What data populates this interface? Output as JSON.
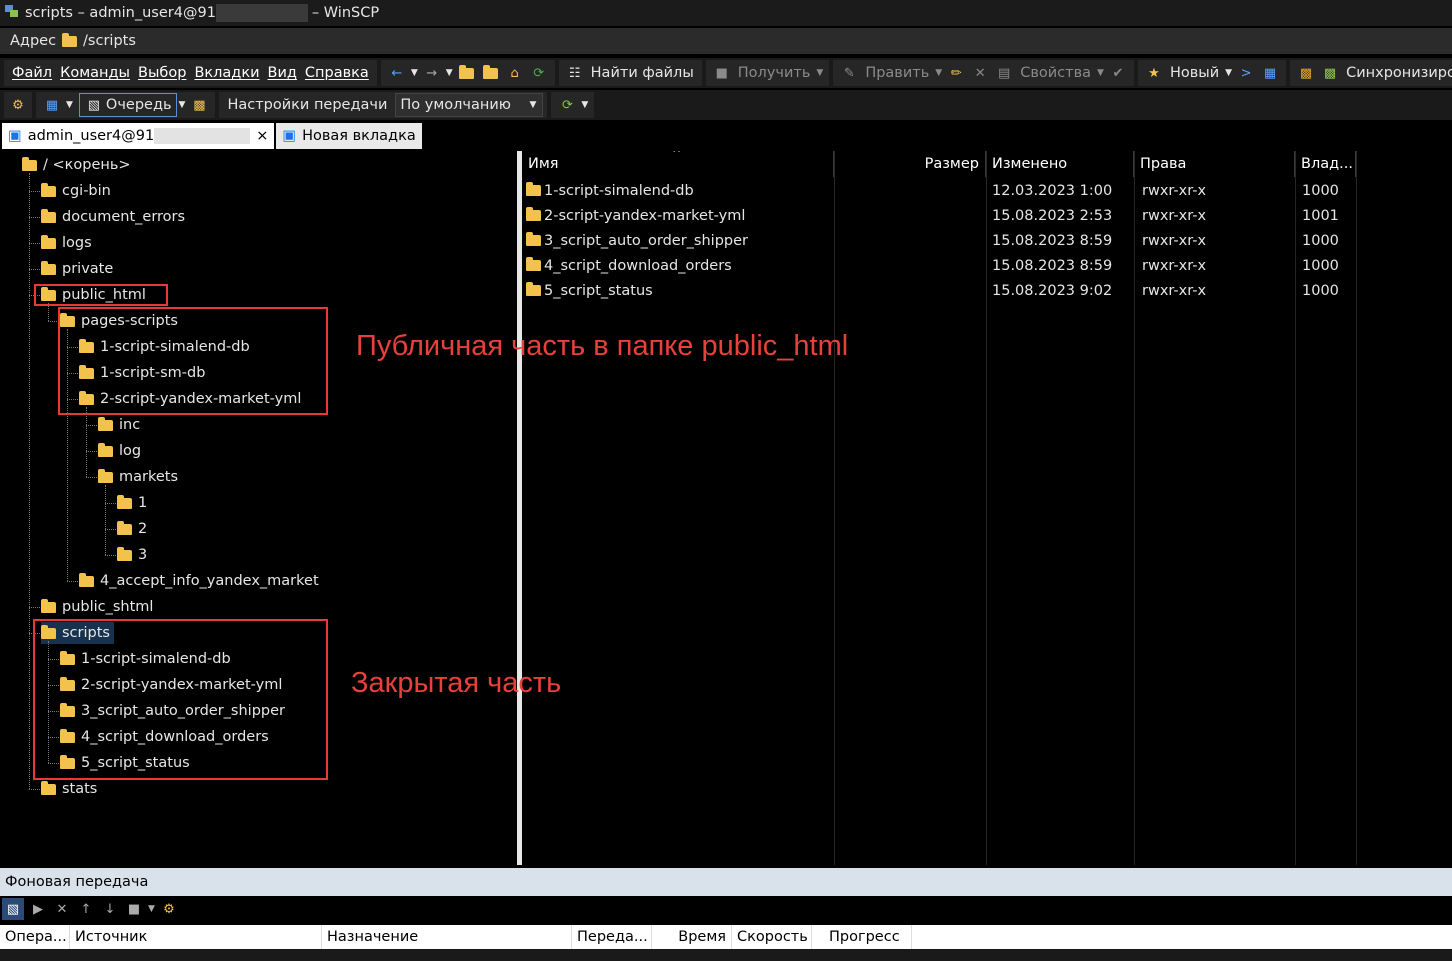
{
  "window": {
    "title_left": "scripts – admin_user4@91",
    "title_right": "– WinSCP"
  },
  "address": {
    "label": "Адрес",
    "path": "/scripts"
  },
  "menu": [
    "Файл",
    "Команды",
    "Выбор",
    "Вкладки",
    "Вид",
    "Справка"
  ],
  "toolbar": {
    "find_files": "Найти файлы",
    "download": "Получить",
    "edit": "Править",
    "properties": "Свойства",
    "new": "Новый",
    "sync": "Синхронизировать",
    "queue": "Очередь",
    "transfer_settings": "Настройки передачи",
    "transfer_preset": "По умолчанию"
  },
  "tabs": [
    {
      "label": "admin_user4@91",
      "close": "×"
    },
    {
      "label": "Новая вкладка"
    }
  ],
  "tree": [
    {
      "label": "/ <корень>",
      "level": 0
    },
    {
      "label": "cgi-bin",
      "level": 1
    },
    {
      "label": "document_errors",
      "level": 1
    },
    {
      "label": "logs",
      "level": 1
    },
    {
      "label": "private",
      "level": 1
    },
    {
      "label": "public_html",
      "level": 1
    },
    {
      "label": "pages-scripts",
      "level": 2
    },
    {
      "label": "1-script-simalend-db",
      "level": 3
    },
    {
      "label": "1-script-sm-db",
      "level": 3
    },
    {
      "label": "2-script-yandex-market-yml",
      "level": 3
    },
    {
      "label": "inc",
      "level": 4
    },
    {
      "label": "log",
      "level": 4
    },
    {
      "label": "markets",
      "level": 4
    },
    {
      "label": "1",
      "level": 5
    },
    {
      "label": "2",
      "level": 5
    },
    {
      "label": "3",
      "level": 5
    },
    {
      "label": "4_accept_info_yandex_market",
      "level": 3
    },
    {
      "label": "public_shtml",
      "level": 1
    },
    {
      "label": "scripts",
      "level": 1,
      "selected": true
    },
    {
      "label": "1-script-simalend-db",
      "level": 2
    },
    {
      "label": "2-script-yandex-market-yml",
      "level": 2
    },
    {
      "label": "3_script_auto_order_shipper",
      "level": 2
    },
    {
      "label": "4_script_download_orders",
      "level": 2
    },
    {
      "label": "5_script_status",
      "level": 2
    },
    {
      "label": "stats",
      "level": 1
    }
  ],
  "annotations": {
    "public": "Публичная часть в папке public_html",
    "private": "Закрытая часть"
  },
  "file_columns": {
    "name": "Имя",
    "size": "Размер",
    "modified": "Изменено",
    "rights": "Права",
    "owner": "Влад..."
  },
  "sort_indicator": "^",
  "files": [
    {
      "name": "1-script-simalend-db",
      "size": "",
      "modified": "12.03.2023 1:00",
      "rights": "rwxr-xr-x",
      "owner": "1000"
    },
    {
      "name": "2-script-yandex-market-yml",
      "size": "",
      "modified": "15.08.2023 2:53",
      "rights": "rwxr-xr-x",
      "owner": "1001"
    },
    {
      "name": "3_script_auto_order_shipper",
      "size": "",
      "modified": "15.08.2023 8:59",
      "rights": "rwxr-xr-x",
      "owner": "1000"
    },
    {
      "name": "4_script_download_orders",
      "size": "",
      "modified": "15.08.2023 8:59",
      "rights": "rwxr-xr-x",
      "owner": "1000"
    },
    {
      "name": "5_script_status",
      "size": "",
      "modified": "15.08.2023 9:02",
      "rights": "rwxr-xr-x",
      "owner": "1000"
    }
  ],
  "queue": {
    "title": "Фоновая передача",
    "columns": [
      "Опера...",
      "Источник",
      "Назначение",
      "Переда...",
      "Время",
      "Скорость",
      "Прогресс"
    ]
  },
  "colors": {
    "annotation": "#e8403a",
    "folder": "#f2c24c",
    "selection": "#17324f"
  }
}
